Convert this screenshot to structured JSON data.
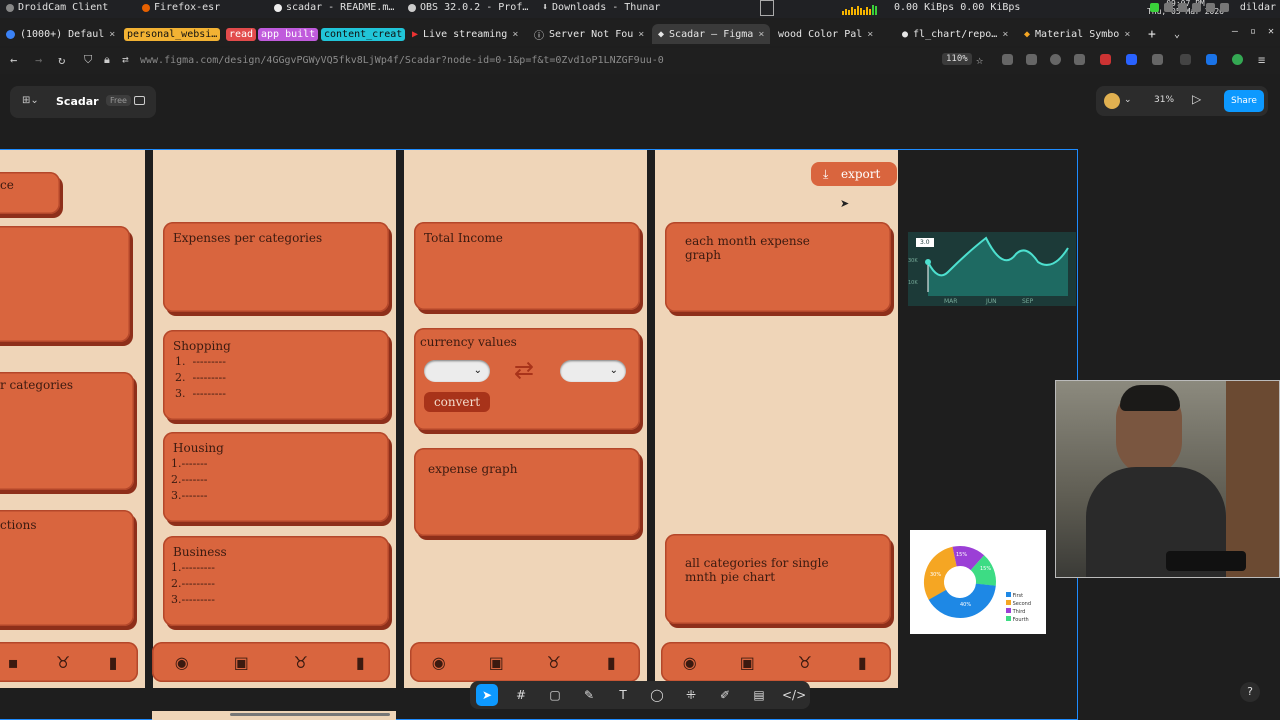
{
  "taskbar": {
    "tasks": [
      "DroidCam Client",
      "Firefox-esr",
      "scadar - README.m…",
      "OBS 32.0.2 - Prof…",
      "Downloads - Thunar"
    ],
    "net_speed": "0.00 KiBps 0.00 KiBps",
    "time": "09:07 PM",
    "date": "Thu, 05 Mar 2026",
    "user": "dildar"
  },
  "tabs": [
    {
      "label": "(1000+) Defaul",
      "close": "×"
    },
    {
      "label": "personal_websi…",
      "tag_color": "#f2b233"
    },
    {
      "label": "read",
      "tag_color": "#e24b4b"
    },
    {
      "label": "app built",
      "tag_color": "#c05bdc"
    },
    {
      "label": "content_creat",
      "tag_color": "#21c5d8"
    },
    {
      "label": "Live streaming",
      "close": "×"
    },
    {
      "label": "Server Not Fou",
      "close": "×"
    },
    {
      "label": "Scadar – Figma",
      "close": "×"
    },
    {
      "label": "wood Color Pal",
      "close": "×"
    },
    {
      "label": "fl_chart/repo…",
      "close": "×"
    },
    {
      "label": "Material Symbo",
      "close": "×"
    }
  ],
  "new_tab": "+",
  "address": {
    "url": "www.figma.com/design/4GGgvPGWyVQ5fkv8LjWp4f/Scadar?node-id=0-1&p=f&t=0Zvd1oP1LNZGF9uu-0",
    "zoom": "110%"
  },
  "figma": {
    "file_name": "Scadar",
    "plan_badge": "Free",
    "zoom": "31%",
    "share_label": "Share"
  },
  "screens": {
    "screen1": {
      "card_top_label": "ce",
      "card_mid_label": "r categories",
      "card_bottom_label": "ctions"
    },
    "screen2": {
      "expenses_title": "Expenses per categories",
      "shopping_title": "Shopping",
      "shopping_items": [
        "1.  ---------",
        "2.  ---------",
        "3.  ---------"
      ],
      "housing_title": "Housing",
      "housing_items": [
        "1.-------",
        "2.-------",
        "3.-------"
      ],
      "business_title": "Business",
      "business_items": [
        "1.---------",
        "2.---------",
        "3.---------"
      ]
    },
    "screen3": {
      "total_income_title": "Total Income",
      "currency_title": "currency values",
      "swap_icon": "⇄",
      "convert_label": "convert",
      "expense_graph_title": "expense graph"
    },
    "screen4": {
      "export_label": "export",
      "monthly_graph_title": "each month expense graph",
      "pie_card_title": "all categories for single mnth pie chart"
    }
  },
  "reference_line_chart": {
    "tooltip": "3.0",
    "y_labels": [
      "30K",
      "10K"
    ],
    "x_labels": [
      "MAR",
      "JUN",
      "SEP"
    ]
  },
  "reference_pie_chart": {
    "slice_labels": [
      "15%",
      "15%",
      "30%",
      "40%"
    ],
    "legend": [
      "First",
      "Second",
      "Third",
      "Fourth"
    ],
    "legend_colors": [
      "#1e88e5",
      "#f5a623",
      "#9b3fd6",
      "#3ddc84"
    ]
  },
  "toolbar": {
    "tools": [
      "move",
      "frame",
      "rectangle",
      "pen",
      "text",
      "comment",
      "actions",
      "draw",
      "dev-mode",
      "code"
    ]
  },
  "help_label": "?"
}
